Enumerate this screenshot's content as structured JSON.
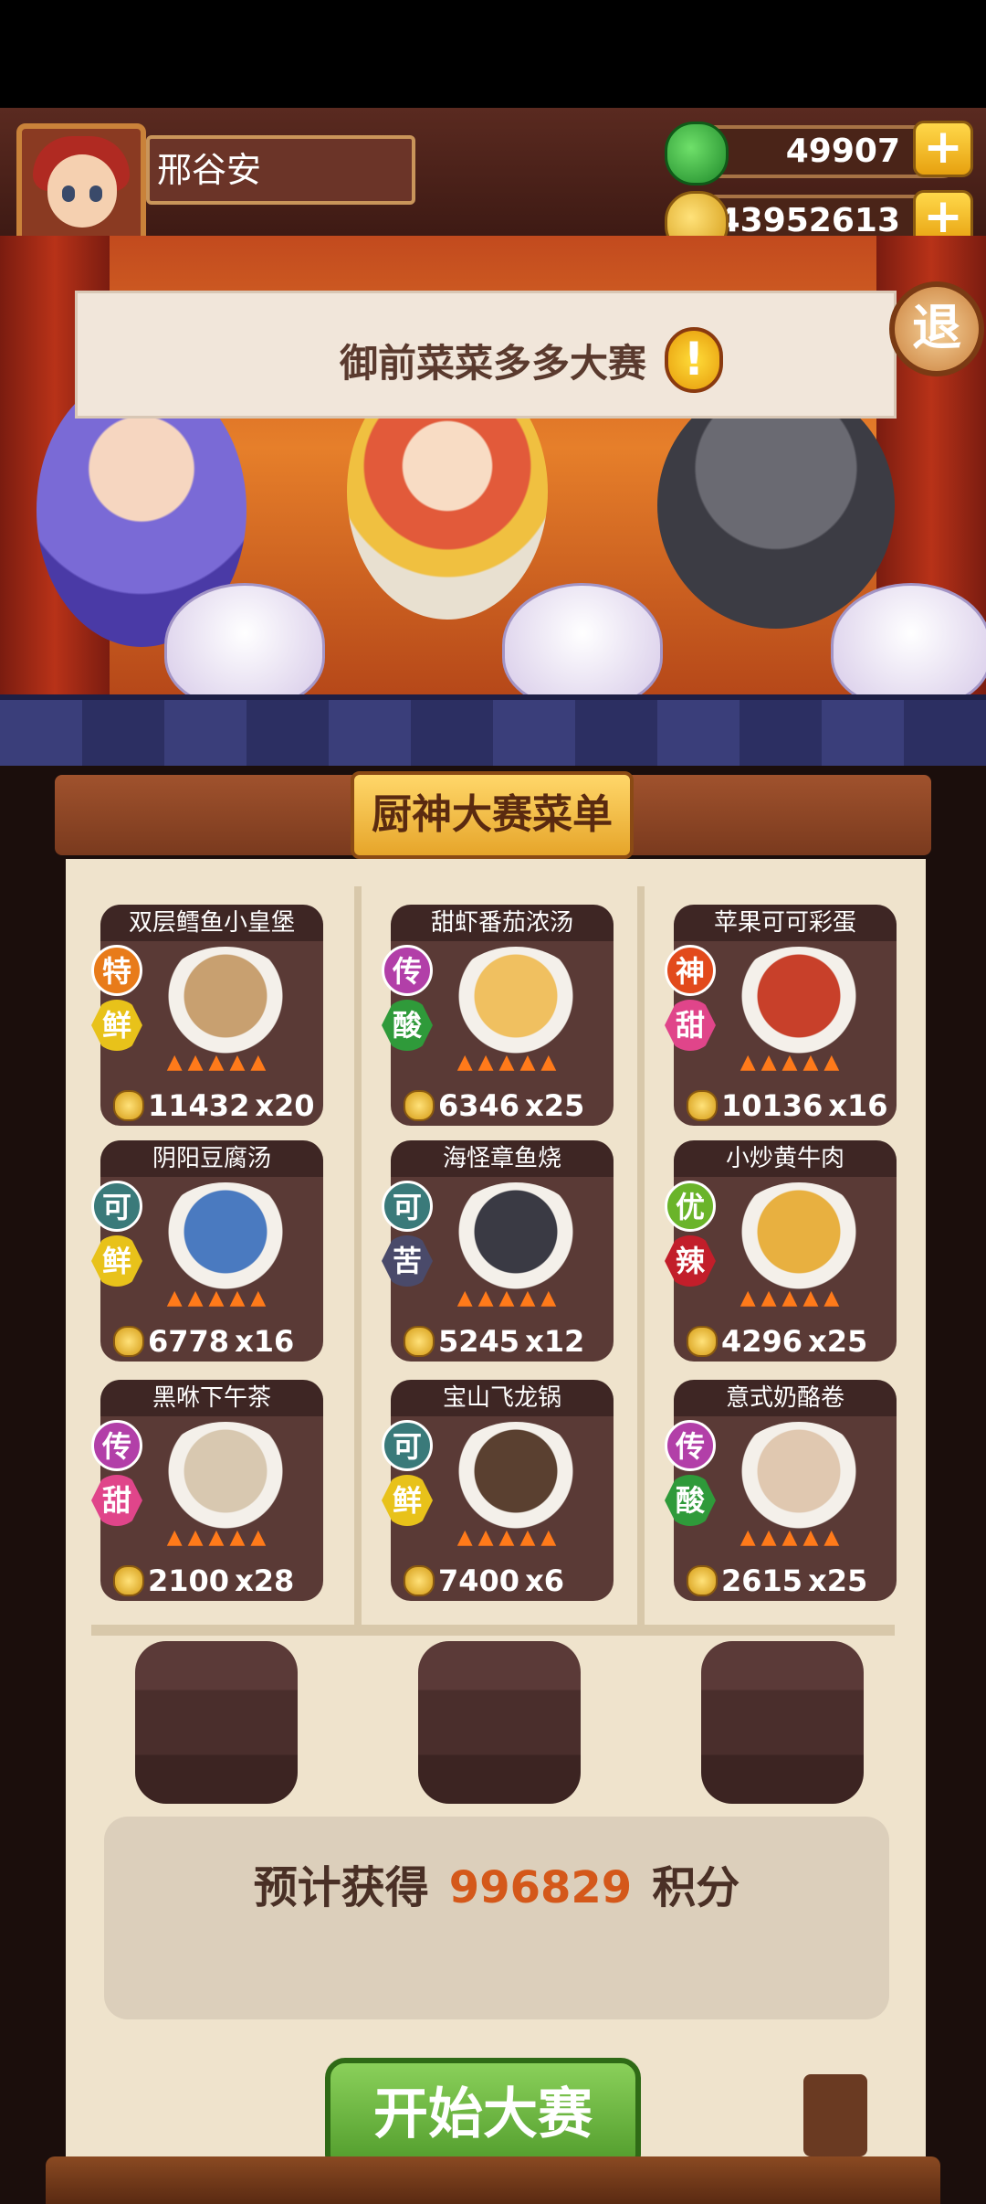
{
  "player": {
    "name": "邢谷安",
    "avatar_icon": "player-avatar"
  },
  "currency": {
    "jade": {
      "icon": "jade-icon",
      "value": "49907"
    },
    "gold": {
      "icon": "gold-coin-icon",
      "value": "43952613"
    },
    "plus_label": "+"
  },
  "event": {
    "title": "御前菜菜多多大赛",
    "alert_label": "!",
    "exit_label": "退"
  },
  "menu": {
    "title": "厨神大赛菜单",
    "dishes": [
      {
        "name": "双层鳕鱼小皇堡",
        "grade": "特",
        "taste": "鲜",
        "price": "11432",
        "qty": "x20"
      },
      {
        "name": "甜虾番茄浓汤",
        "grade": "传",
        "taste": "酸",
        "price": "6346",
        "qty": "x25"
      },
      {
        "name": "苹果可可彩蛋",
        "grade": "神",
        "taste": "甜",
        "price": "10136",
        "qty": "x16"
      },
      {
        "name": "阴阳豆腐汤",
        "grade": "可",
        "taste": "鲜",
        "price": "6778",
        "qty": "x16"
      },
      {
        "name": "海怪章鱼烧",
        "grade": "可",
        "taste": "苦",
        "price": "5245",
        "qty": "x12"
      },
      {
        "name": "小炒黄牛肉",
        "grade": "优",
        "taste": "辣",
        "price": "4296",
        "qty": "x25"
      },
      {
        "name": "黑咻下午茶",
        "grade": "传",
        "taste": "甜",
        "price": "2100",
        "qty": "x28"
      },
      {
        "name": "宝山飞龙锅",
        "grade": "可",
        "taste": "鲜",
        "price": "7400",
        "qty": "x6"
      },
      {
        "name": "意式奶酪卷",
        "grade": "传",
        "taste": "酸",
        "price": "2615",
        "qty": "x25"
      }
    ]
  },
  "estimate": {
    "label": "预计获得",
    "value": "996829",
    "unit": "积分"
  },
  "start_button": "开始大赛",
  "colors": {
    "accent_orange": "#d4581a",
    "start_green": "#4f9a2a",
    "paper": "#efe3cc"
  }
}
